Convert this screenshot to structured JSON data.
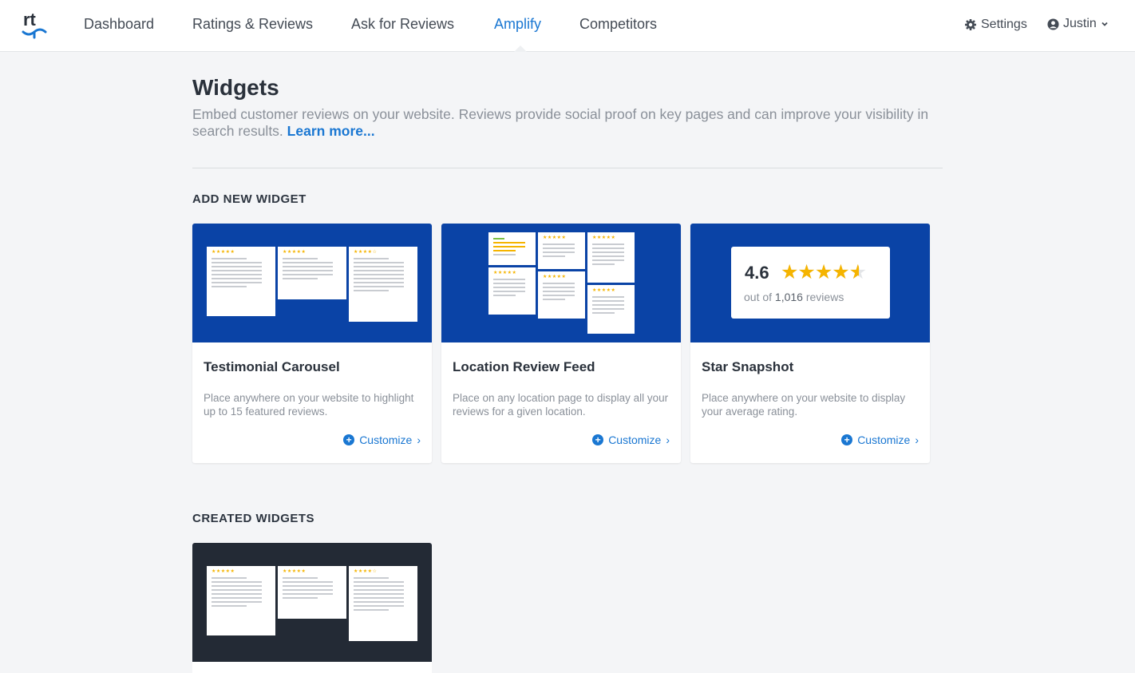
{
  "header": {
    "logo_text": "rt",
    "nav": [
      "Dashboard",
      "Ratings & Reviews",
      "Ask for Reviews",
      "Amplify",
      "Competitors"
    ],
    "active_nav": "Amplify",
    "settings_label": "Settings",
    "user_label": "Justin"
  },
  "page": {
    "title": "Widgets",
    "intro": "Embed customer reviews on your website. Reviews provide social proof on key pages and can improve your visibility in search results.",
    "learn_more": "Learn more..."
  },
  "sections": {
    "add_new": "ADD NEW WIDGET",
    "created": "CREATED WIDGETS"
  },
  "widgets": [
    {
      "title": "Testimonial Carousel",
      "description": "Place anywhere on your website to highlight up to 15 featured reviews.",
      "action": "Customize"
    },
    {
      "title": "Location Review Feed",
      "description": "Place on any location page to display all your reviews for a given location.",
      "action": "Customize"
    },
    {
      "title": "Star Snapshot",
      "description": "Place anywhere on your website to display your average rating.",
      "action": "Customize"
    }
  ],
  "snapshot": {
    "rating": "4.6",
    "rating_value": 4.6,
    "stars": "★★★★★",
    "sub_prefix": "out of ",
    "sub_count": "1,016",
    "sub_suffix": " reviews"
  },
  "colors": {
    "accent": "#1a77d2",
    "thumb_blue": "#0a43a6",
    "thumb_dark": "#232a35",
    "star": "#f5b400"
  }
}
